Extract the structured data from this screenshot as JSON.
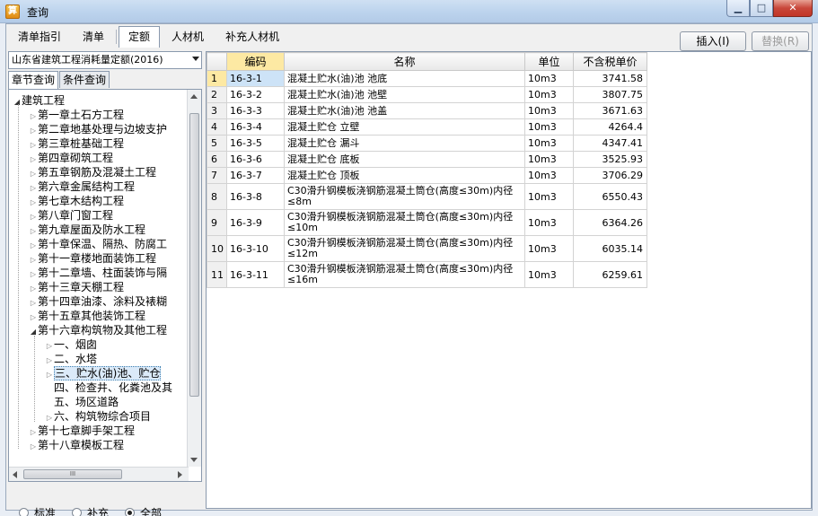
{
  "window": {
    "title": "查询",
    "app_icon_glyph": "算"
  },
  "tabs": [
    {
      "label": "清单指引",
      "active": false
    },
    {
      "label": "清单",
      "active": false
    },
    {
      "label": "定额",
      "active": true
    },
    {
      "label": "人材机",
      "active": false
    },
    {
      "label": "补充人材机",
      "active": false
    }
  ],
  "toolbar": {
    "insert_label": "插入(I)",
    "replace_label": "替换(R)"
  },
  "left": {
    "combo_value": "山东省建筑工程消耗量定额(2016)",
    "subtabs": [
      {
        "label": "章节查询",
        "active": true
      },
      {
        "label": "条件查询",
        "active": false
      }
    ],
    "tree": [
      {
        "label": "建筑工程",
        "level": 0,
        "state": "open"
      },
      {
        "label": "第一章土石方工程",
        "level": 1,
        "state": "closed"
      },
      {
        "label": "第二章地基处理与边坡支护",
        "level": 1,
        "state": "closed"
      },
      {
        "label": "第三章桩基础工程",
        "level": 1,
        "state": "closed"
      },
      {
        "label": "第四章砌筑工程",
        "level": 1,
        "state": "closed"
      },
      {
        "label": "第五章钢筋及混凝土工程",
        "level": 1,
        "state": "closed"
      },
      {
        "label": "第六章金属结构工程",
        "level": 1,
        "state": "closed"
      },
      {
        "label": "第七章木结构工程",
        "level": 1,
        "state": "closed"
      },
      {
        "label": "第八章门窗工程",
        "level": 1,
        "state": "closed"
      },
      {
        "label": "第九章屋面及防水工程",
        "level": 1,
        "state": "closed"
      },
      {
        "label": "第十章保温、隔热、防腐工",
        "level": 1,
        "state": "closed"
      },
      {
        "label": "第十一章楼地面装饰工程",
        "level": 1,
        "state": "closed"
      },
      {
        "label": "第十二章墙、柱面装饰与隔",
        "level": 1,
        "state": "closed"
      },
      {
        "label": "第十三章天棚工程",
        "level": 1,
        "state": "closed"
      },
      {
        "label": "第十四章油漆、涂料及裱糊",
        "level": 1,
        "state": "closed"
      },
      {
        "label": "第十五章其他装饰工程",
        "level": 1,
        "state": "closed"
      },
      {
        "label": "第十六章构筑物及其他工程",
        "level": 1,
        "state": "open"
      },
      {
        "label": "一、烟囱",
        "level": 2,
        "state": "closed"
      },
      {
        "label": "二、水塔",
        "level": 2,
        "state": "closed"
      },
      {
        "label": "三、贮水(油)池、贮仓",
        "level": 2,
        "state": "closed",
        "selected": true
      },
      {
        "label": "四、检查井、化粪池及其",
        "level": 2,
        "state": "leaf"
      },
      {
        "label": "五、场区道路",
        "level": 2,
        "state": "leaf"
      },
      {
        "label": "六、构筑物综合项目",
        "level": 2,
        "state": "closed"
      },
      {
        "label": "第十七章脚手架工程",
        "level": 1,
        "state": "closed"
      },
      {
        "label": "第十八章模板工程",
        "level": 1,
        "state": "closed"
      }
    ],
    "hscroll_glyph": "III",
    "radios": [
      {
        "label": "标准",
        "checked": false
      },
      {
        "label": "补充",
        "checked": false
      },
      {
        "label": "全部",
        "checked": true
      }
    ]
  },
  "grid": {
    "columns": [
      "编码",
      "名称",
      "单位",
      "不含税单价"
    ],
    "rows": [
      {
        "num": "1",
        "code": "16-3-1",
        "name": "混凝土贮水(油)池 池底",
        "unit": "10m3",
        "price": "3741.58"
      },
      {
        "num": "2",
        "code": "16-3-2",
        "name": "混凝土贮水(油)池 池壁",
        "unit": "10m3",
        "price": "3807.75"
      },
      {
        "num": "3",
        "code": "16-3-3",
        "name": "混凝土贮水(油)池 池盖",
        "unit": "10m3",
        "price": "3671.63"
      },
      {
        "num": "4",
        "code": "16-3-4",
        "name": "混凝土贮仓 立壁",
        "unit": "10m3",
        "price": "4264.4"
      },
      {
        "num": "5",
        "code": "16-3-5",
        "name": "混凝土贮仓 漏斗",
        "unit": "10m3",
        "price": "4347.41"
      },
      {
        "num": "6",
        "code": "16-3-6",
        "name": "混凝土贮仓 底板",
        "unit": "10m3",
        "price": "3525.93"
      },
      {
        "num": "7",
        "code": "16-3-7",
        "name": "混凝土贮仓 顶板",
        "unit": "10m3",
        "price": "3706.29"
      },
      {
        "num": "8",
        "code": "16-3-8",
        "name": "C30滑升钢模板浇钢筋混凝土筒仓(高度≤30m)内径≤8m",
        "unit": "10m3",
        "price": "6550.43"
      },
      {
        "num": "9",
        "code": "16-3-9",
        "name": "C30滑升钢模板浇钢筋混凝土筒仓(高度≤30m)内径≤10m",
        "unit": "10m3",
        "price": "6364.26"
      },
      {
        "num": "10",
        "code": "16-3-10",
        "name": "C30滑升钢模板浇钢筋混凝土筒仓(高度≤30m)内径≤12m",
        "unit": "10m3",
        "price": "6035.14"
      },
      {
        "num": "11",
        "code": "16-3-11",
        "name": "C30滑升钢模板浇钢筋混凝土筒仓(高度≤30m)内径≤16m",
        "unit": "10m3",
        "price": "6259.61"
      }
    ]
  }
}
